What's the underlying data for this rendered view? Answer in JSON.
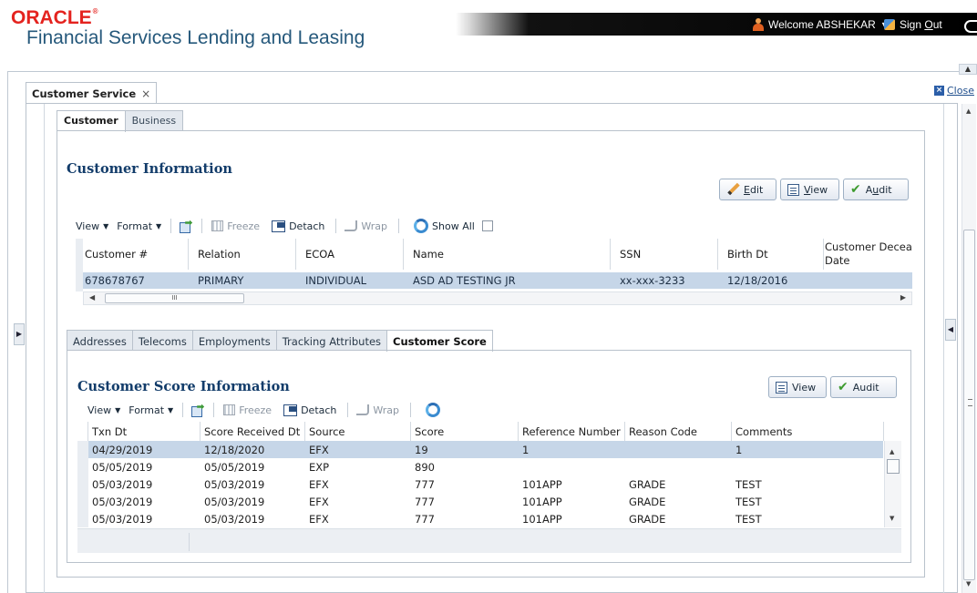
{
  "header": {
    "logo_text": "ORACLE",
    "logo_tm": "®",
    "app_title": "Financial Services Lending and Leasing",
    "welcome": "Welcome ABSHEKAR",
    "sign_out": {
      "pre": "Sign ",
      "underlined": "O",
      "post": "ut"
    }
  },
  "workspace": {
    "tab_title": "Customer Service",
    "tab_close": "×",
    "close_label": "Close",
    "close_icon": "×"
  },
  "customer_tabs": [
    "Customer",
    "Business"
  ],
  "customer_info": {
    "title": "Customer Information",
    "buttons": {
      "edit": {
        "u": "E",
        "rest": "dit"
      },
      "view": {
        "u": "V",
        "rest": "iew"
      },
      "audit": {
        "pre": "A",
        "u": "u",
        "rest": "dit"
      }
    },
    "toolbar": {
      "view": "View",
      "format": "Format",
      "freeze": "Freeze",
      "detach": "Detach",
      "wrap": "Wrap",
      "show_all": "Show All"
    },
    "columns": [
      "Customer #",
      "Relation",
      "ECOA",
      "Name",
      "SSN",
      "Birth Dt",
      "Customer Deceased Date"
    ],
    "columns_visible": [
      "Customer #",
      "Relation",
      "ECOA",
      "Name",
      "SSN",
      "Birth Dt",
      "Customer Deceas",
      "Date"
    ],
    "row": {
      "customer_no": "678678767",
      "relation": "PRIMARY",
      "ecoa": "INDIVIDUAL",
      "name": "ASD AD TESTING JR",
      "ssn": "xx-xxx-3233",
      "birth_dt": "12/18/2016",
      "deceased_dt": ""
    },
    "scroll_grip": "III"
  },
  "sub_tabs": [
    "Addresses",
    "Telecoms",
    "Employments",
    "Tracking Attributes",
    "Customer Score"
  ],
  "score_info": {
    "title": "Customer Score Information",
    "buttons": {
      "view": "View",
      "audit": "Audit"
    },
    "toolbar": {
      "view": "View",
      "format": "Format",
      "freeze": "Freeze",
      "detach": "Detach",
      "wrap": "Wrap"
    },
    "columns": [
      "Txn Dt",
      "Score Received Dt",
      "Source",
      "Score",
      "Reference Number",
      "Reason Code",
      "Comments"
    ],
    "rows": [
      {
        "txn_dt": "04/29/2019",
        "received_dt": "12/18/2020",
        "source": "EFX",
        "score": "19",
        "ref": "1",
        "reason": "",
        "comments": "1"
      },
      {
        "txn_dt": "05/05/2019",
        "received_dt": "05/05/2019",
        "source": "EXP",
        "score": "890",
        "ref": "",
        "reason": "",
        "comments": ""
      },
      {
        "txn_dt": "05/03/2019",
        "received_dt": "05/03/2019",
        "source": "EFX",
        "score": "777",
        "ref": "101APP",
        "reason": "GRADE",
        "comments": "TEST"
      },
      {
        "txn_dt": "05/03/2019",
        "received_dt": "05/03/2019",
        "source": "EFX",
        "score": "777",
        "ref": "101APP",
        "reason": "GRADE",
        "comments": "TEST"
      },
      {
        "txn_dt": "05/03/2019",
        "received_dt": "05/03/2019",
        "source": "EFX",
        "score": "777",
        "ref": "101APP",
        "reason": "GRADE",
        "comments": "TEST"
      }
    ]
  },
  "icons": [
    "user-icon",
    "sign-out-icon",
    "close-icon",
    "pencil-icon",
    "view-doc-icon",
    "audit-check-icon",
    "export-icon",
    "freeze-icon",
    "detach-icon",
    "wrap-icon",
    "refresh-icon"
  ],
  "colors": {
    "brand_red": "#e4231f",
    "title_blue": "#25587b",
    "section_title": "#123c6a",
    "selected_row": "#c6d6e8"
  }
}
